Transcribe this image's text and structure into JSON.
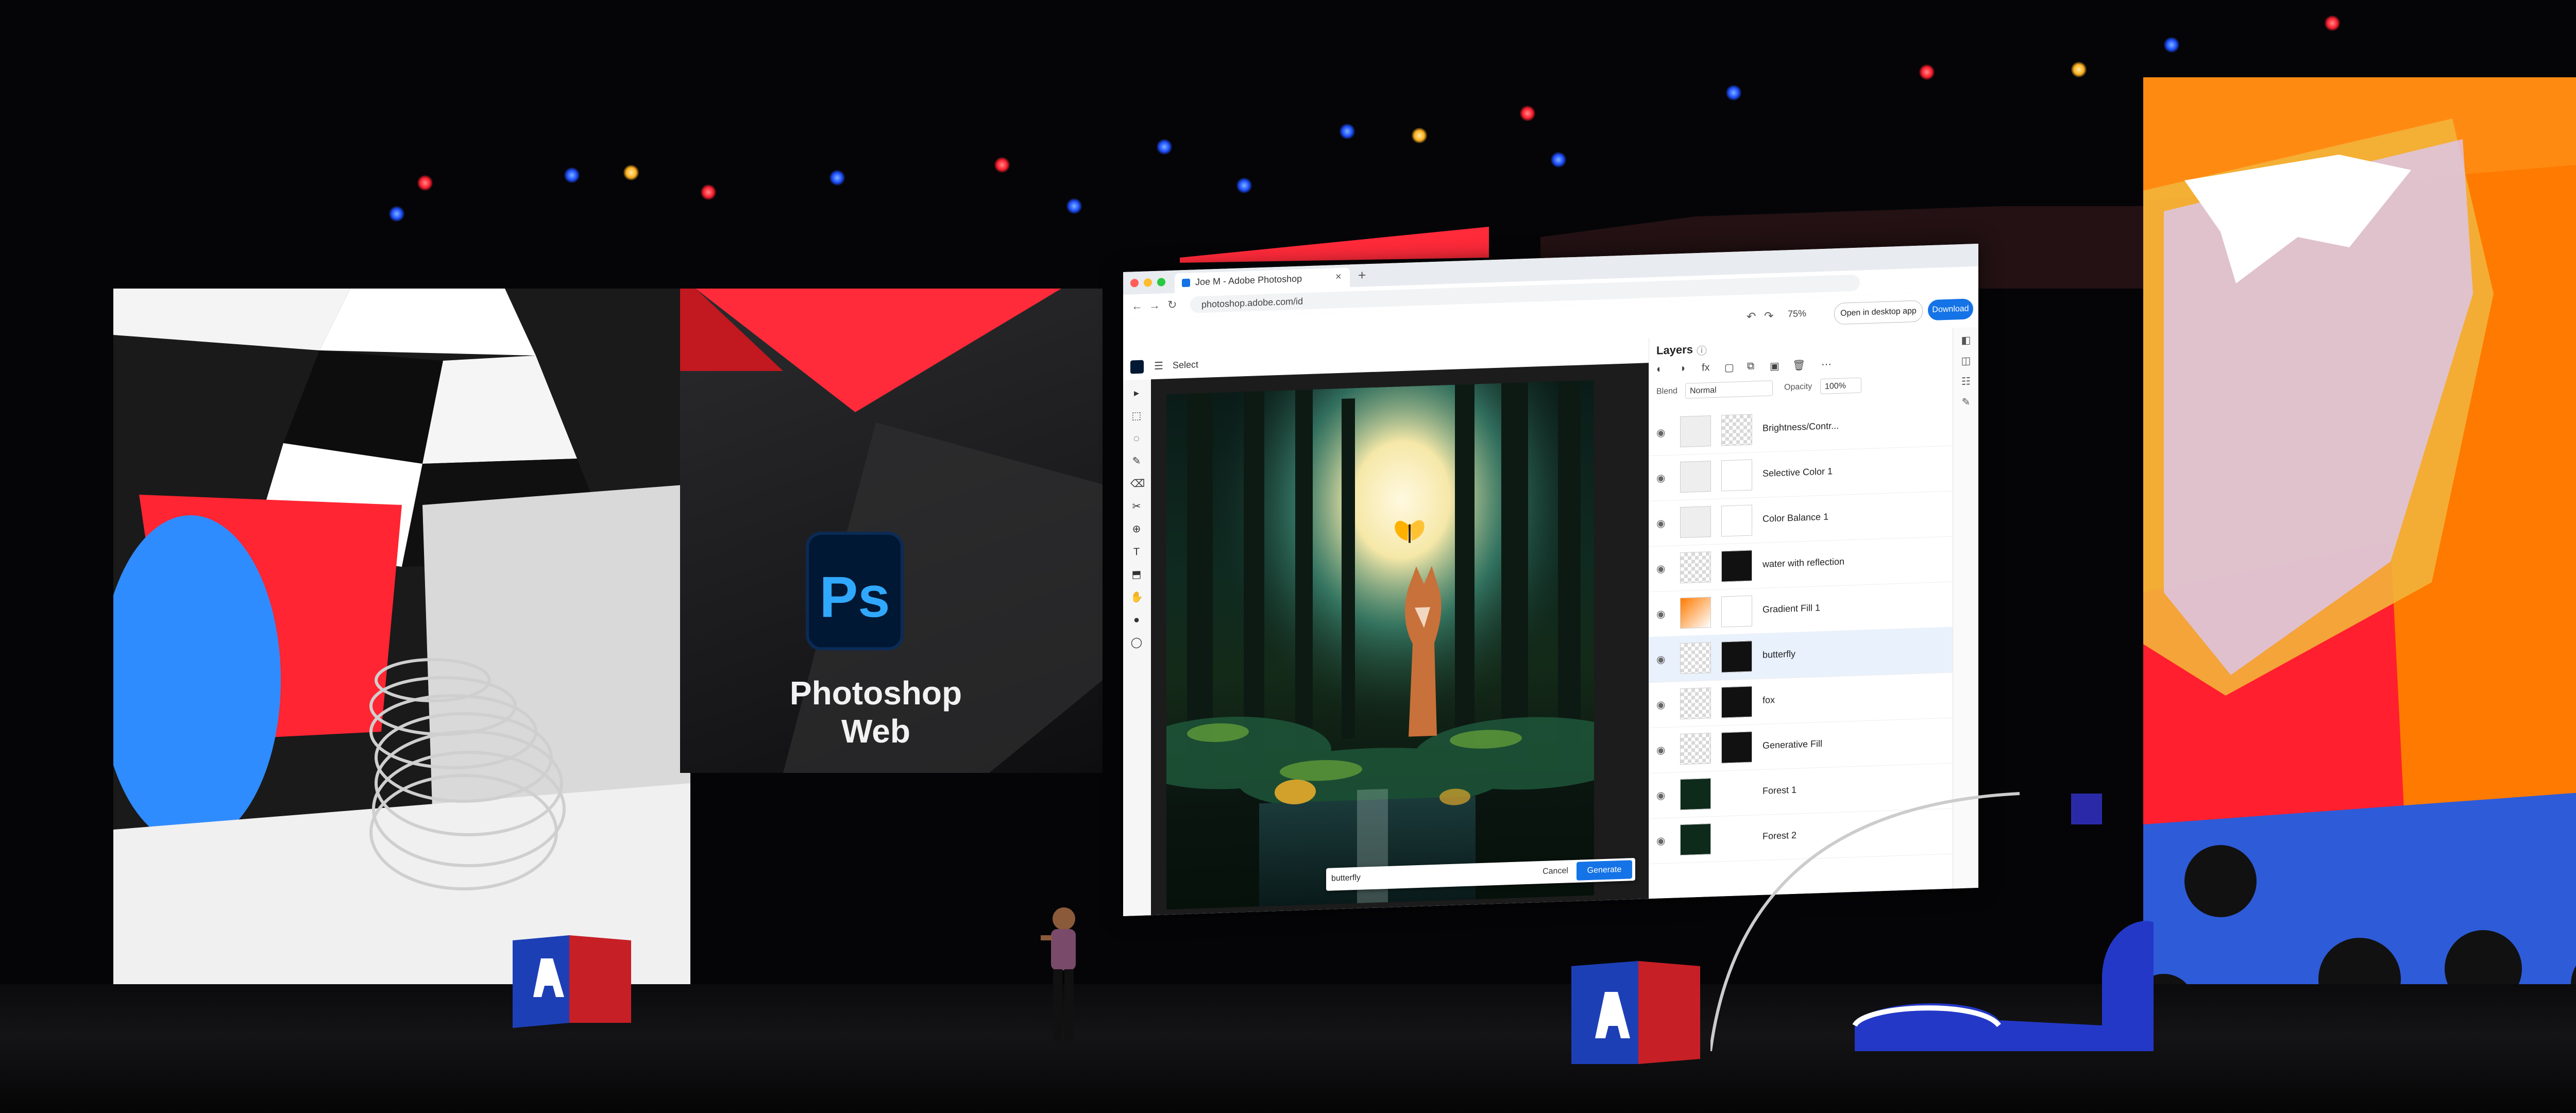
{
  "ps_panel": {
    "logo_text": "Ps",
    "title": "Photoshop Web"
  },
  "browser": {
    "tab_label": "Joe M - Adobe Photoshop",
    "tab_close": "×",
    "new_tab": "+",
    "url": "photoshop.adobe.com/id",
    "nav_back": "←",
    "nav_forward": "→",
    "nav_reload": "↻"
  },
  "ps_header": {
    "undo": "↶",
    "redo": "↷",
    "zoom": "75%",
    "open_desktop": "Open in desktop app",
    "download": "Download"
  },
  "options_bar": {
    "menu_icon": "☰",
    "select_label": "Select"
  },
  "tools": [
    "▸",
    "⬚",
    "◌",
    "✎",
    "⌫",
    "✂",
    "⊕",
    "T",
    "⬒",
    "✋",
    "●",
    "◯"
  ],
  "generative_bar": {
    "prompt_value": "butterfly",
    "cancel": "Cancel",
    "generate": "Generate"
  },
  "layers_panel": {
    "title": "Layers",
    "info_icon": "ⓘ",
    "actions": [
      "◐",
      "◑",
      "fx",
      "▢",
      "⧉",
      "▣",
      "🗑",
      "⋯"
    ],
    "blend_label": "Blend",
    "blend_value": "Normal",
    "opacity_label": "Opacity",
    "opacity_value": "100%",
    "layers": [
      {
        "name": "Brightness/Contr...",
        "selected": false
      },
      {
        "name": "Selective Color 1",
        "selected": false
      },
      {
        "name": "Color Balance 1",
        "selected": false
      },
      {
        "name": "water with reflection",
        "selected": false
      },
      {
        "name": "Gradient Fill 1",
        "selected": false
      },
      {
        "name": "butterfly",
        "selected": true
      },
      {
        "name": "fox",
        "selected": false
      },
      {
        "name": "Generative Fill",
        "selected": false
      },
      {
        "name": "Forest 1",
        "selected": false
      },
      {
        "name": "Forest 2",
        "selected": false
      }
    ]
  },
  "rail_icons": [
    "◧",
    "◫",
    "☷",
    "✎"
  ],
  "colors": {
    "accent": "#1473e6",
    "ps_blue": "#31a8ff",
    "adobe_red": "#ff1e2e",
    "orange": "#ff7a00"
  }
}
